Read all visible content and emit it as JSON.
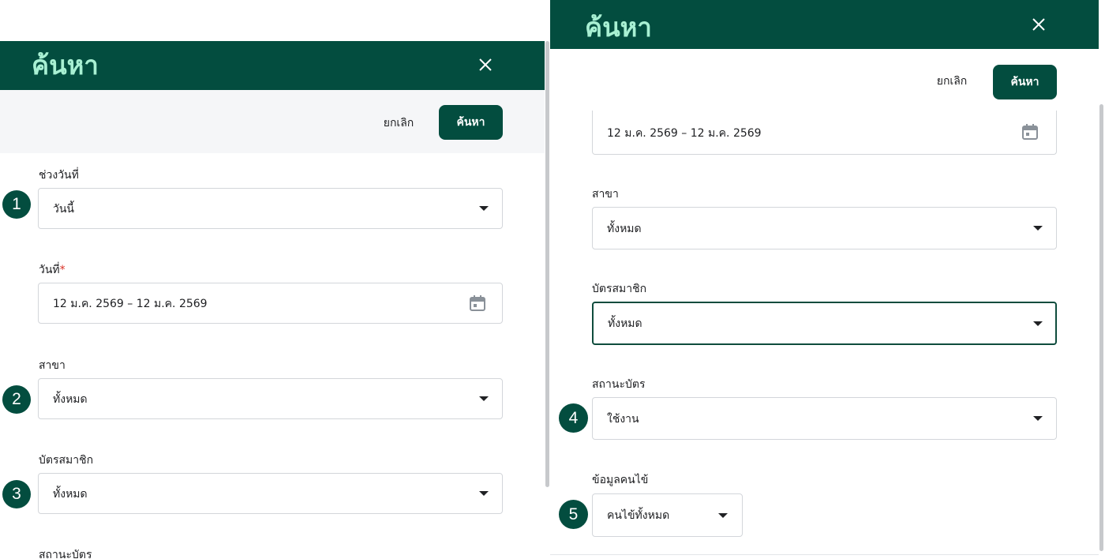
{
  "left": {
    "title": "ค้นหา",
    "cancel_label": "ยกเลิก",
    "search_label": "ค้นหา",
    "fields": {
      "date_range": {
        "label": "ช่วงวันที่",
        "value": "วันนี้"
      },
      "date": {
        "label": "วันที่",
        "required_mark": "*",
        "value": "12 ม.ค. 2569 – 12 ม.ค. 2569"
      },
      "branch": {
        "label": "สาขา",
        "value": "ทั้งหมด"
      },
      "member_card": {
        "label": "บัตรสมาชิก",
        "value": "ทั้งหมด"
      },
      "card_status": {
        "label": "สถานะบัตร"
      }
    },
    "badges": [
      "1",
      "2",
      "3"
    ]
  },
  "right": {
    "title": "ค้นหา",
    "cancel_label": "ยกเลิก",
    "search_label": "ค้นหา",
    "fields": {
      "date": {
        "value": "12 ม.ค. 2569 – 12 ม.ค. 2569"
      },
      "branch": {
        "label": "สาขา",
        "value": "ทั้งหมด"
      },
      "member_card": {
        "label": "บัตรสมาชิก",
        "value": "ทั้งหมด"
      },
      "card_status": {
        "label": "สถานะบัตร",
        "value": "ใช้งาน"
      },
      "patient_info": {
        "label": "ข้อมูลคนไข้",
        "value": "คนไข้ทั้งหมด"
      }
    },
    "badges": [
      "4",
      "5"
    ]
  },
  "colors": {
    "header_bg": "#034d3f",
    "title_text": "#a8f0d3",
    "primary_button": "#034d3f",
    "badge": "#034d3f",
    "required": "#d93025"
  },
  "icons": [
    "close-icon",
    "dropdown-caret-icon",
    "calendar-icon"
  ]
}
